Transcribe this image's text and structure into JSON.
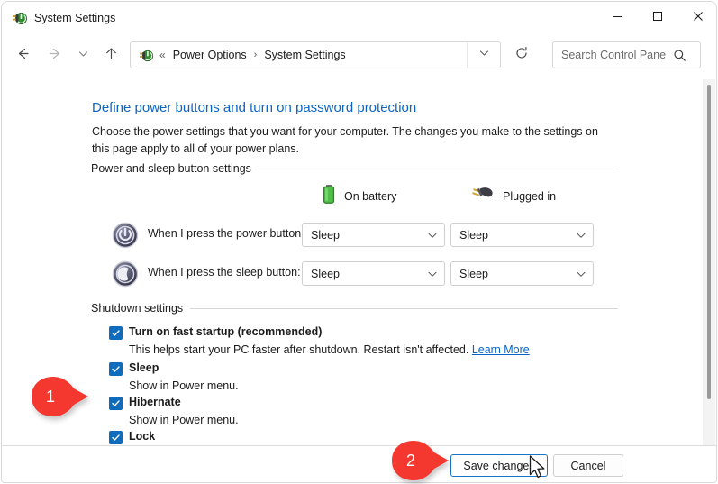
{
  "window": {
    "title": "System Settings",
    "app_icon": "power-plug-icon",
    "caption": {
      "minimize_label": "Minimize",
      "maximize_label": "Maximize",
      "close_label": "Close"
    }
  },
  "navbar": {
    "back_label": "Back",
    "forward_label": "Forward",
    "recent_label": "Recent locations",
    "up_label": "Up one level",
    "address": {
      "icon": "power-plug-icon",
      "prefix": "«",
      "crumb1": "Power Options",
      "separator": "›",
      "crumb2": "System Settings",
      "dropdown_label": "Previous locations"
    },
    "refresh_label": "Refresh",
    "search": {
      "placeholder": "Search Control Panel",
      "value": "",
      "icon": "search-icon"
    }
  },
  "page": {
    "title": "Define power buttons and turn on password protection",
    "description": "Choose the power settings that you want for your computer. The changes you make to the settings on this page apply to all of your power plans."
  },
  "sections": {
    "power_sleep": {
      "label": "Power and sleep button settings",
      "columns": [
        {
          "icon": "battery-icon",
          "label": "On battery"
        },
        {
          "icon": "power-plug-icon",
          "label": "Plugged in"
        }
      ],
      "rows": [
        {
          "icon": "power-button-icon",
          "label": "When I press the power button:",
          "on_battery": "Sleep",
          "plugged_in": "Sleep"
        },
        {
          "icon": "sleep-moon-icon",
          "label": "When I press the sleep button:",
          "on_battery": "Sleep",
          "plugged_in": "Sleep"
        }
      ]
    },
    "shutdown": {
      "label": "Shutdown settings",
      "items": [
        {
          "title": "Turn on fast startup (recommended)",
          "checked": true,
          "sub": "This helps start your PC faster after shutdown. Restart isn't affected.",
          "link": "Learn More"
        },
        {
          "title": "Sleep",
          "checked": true,
          "sub": "Show in Power menu.",
          "link": ""
        },
        {
          "title": "Hibernate",
          "checked": true,
          "sub": "Show in Power menu.",
          "link": ""
        },
        {
          "title": "Lock",
          "checked": true,
          "sub": "",
          "link": ""
        }
      ]
    }
  },
  "footer": {
    "save_label": "Save changes",
    "cancel_label": "Cancel"
  },
  "annotations": [
    {
      "number": "1",
      "color": "#f4372f"
    },
    {
      "number": "2",
      "color": "#f4372f"
    }
  ],
  "colors": {
    "link": "#0b64c5",
    "heading": "#0b64c5",
    "checkbox": "#0f6cbd",
    "focus_border": "#1675c6",
    "callout": "#f4372f"
  },
  "scrollbar": {
    "position": "top"
  }
}
